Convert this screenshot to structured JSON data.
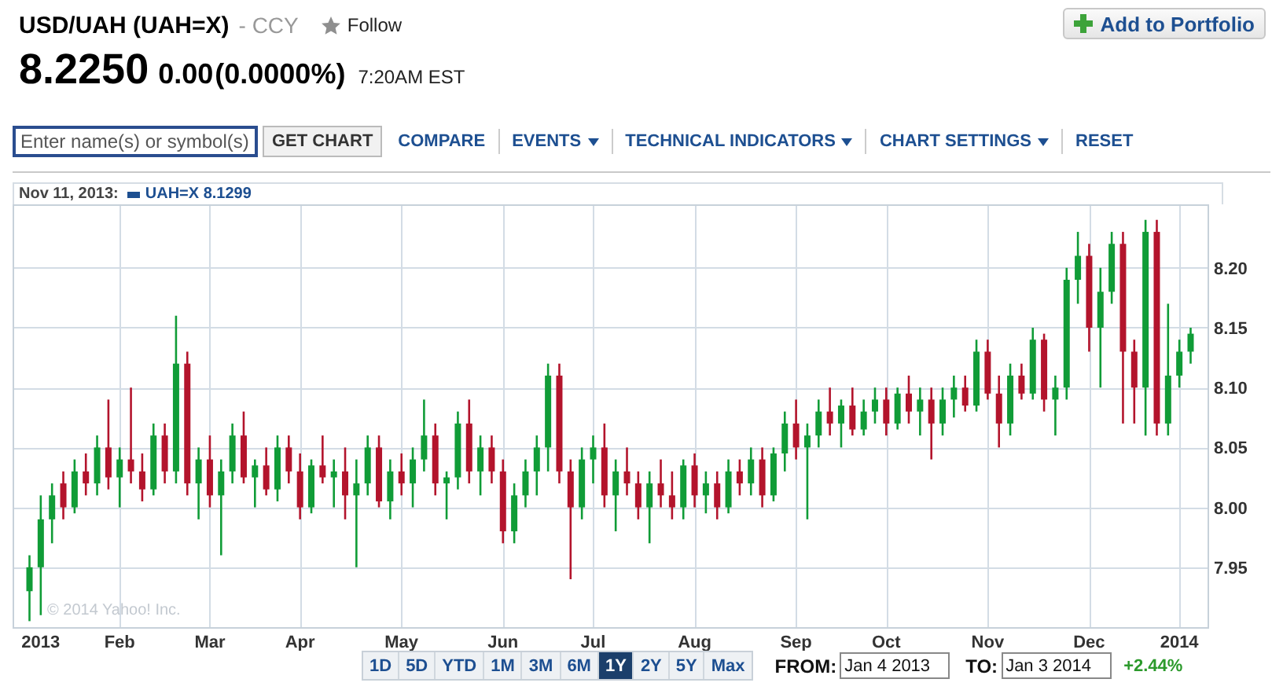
{
  "quote": {
    "title": "USD/UAH (UAH=X)",
    "exchange": "- CCY",
    "follow": "Follow",
    "price": "8.2250",
    "change": "0.00",
    "change_percent": "(0.0000%)",
    "time": "7:20AM EST"
  },
  "add_button": "Add to Portfolio",
  "toolbar": {
    "search": {
      "placeholder": "Enter name(s) or symbol(s)"
    },
    "get_chart": "GET CHART",
    "menu": [
      {
        "label": "COMPARE",
        "dropdown": false
      },
      {
        "label": "EVENTS",
        "dropdown": true
      },
      {
        "label": "TECHNICAL INDICATORS",
        "dropdown": true
      },
      {
        "label": "CHART SETTINGS",
        "dropdown": true
      },
      {
        "label": "RESET",
        "dropdown": false
      }
    ]
  },
  "chart": {
    "hover_date": "Nov 11, 2013:",
    "legend": "UAH=X 8.1299",
    "credit": "© 2014 Yahoo! Inc.",
    "chart_data": {
      "type": "candlestick",
      "categories": [
        null,
        "2013",
        null,
        null,
        null,
        null,
        null,
        null,
        "Feb",
        null,
        null,
        null,
        null,
        null,
        null,
        null,
        "Mar",
        null,
        null,
        null,
        null,
        null,
        null,
        null,
        "Apr",
        null,
        null,
        null,
        null,
        null,
        null,
        null,
        null,
        "May",
        null,
        null,
        null,
        null,
        null,
        null,
        null,
        null,
        "Jun",
        null,
        null,
        null,
        null,
        null,
        null,
        null,
        "Jul",
        null,
        null,
        null,
        null,
        null,
        null,
        null,
        null,
        "Aug",
        null,
        null,
        null,
        null,
        null,
        null,
        null,
        null,
        "Sep",
        null,
        null,
        null,
        null,
        null,
        null,
        null,
        "Oct",
        null,
        null,
        null,
        null,
        null,
        null,
        null,
        null,
        "Nov",
        null,
        null,
        null,
        null,
        null,
        null,
        null,
        null,
        "Dec",
        null,
        null,
        null,
        null,
        null,
        null,
        null,
        "2014",
        null
      ],
      "ohlc": [
        [
          7.93,
          7.96,
          7.905,
          7.95
        ],
        [
          7.95,
          8.01,
          7.91,
          7.99
        ],
        [
          7.99,
          8.02,
          7.97,
          8.01
        ],
        [
          8.02,
          8.03,
          7.99,
          8.0
        ],
        [
          8.0,
          8.04,
          7.995,
          8.03
        ],
        [
          8.03,
          8.045,
          8.01,
          8.02
        ],
        [
          8.02,
          8.06,
          8.01,
          8.05
        ],
        [
          8.05,
          8.09,
          8.015,
          8.025
        ],
        [
          8.025,
          8.05,
          8.0,
          8.04
        ],
        [
          8.04,
          8.1,
          8.02,
          8.03
        ],
        [
          8.03,
          8.045,
          8.005,
          8.015
        ],
        [
          8.015,
          8.07,
          8.01,
          8.06
        ],
        [
          8.06,
          8.07,
          8.02,
          8.03
        ],
        [
          8.03,
          8.16,
          8.02,
          8.12
        ],
        [
          8.12,
          8.13,
          8.01,
          8.02
        ],
        [
          8.02,
          8.05,
          7.99,
          8.04
        ],
        [
          8.04,
          8.06,
          8.0,
          8.01
        ],
        [
          8.01,
          8.04,
          7.96,
          8.03
        ],
        [
          8.03,
          8.07,
          8.02,
          8.06
        ],
        [
          8.06,
          8.08,
          8.02,
          8.025
        ],
        [
          8.025,
          8.04,
          8.0,
          8.035
        ],
        [
          8.035,
          8.05,
          8.01,
          8.015
        ],
        [
          8.015,
          8.06,
          8.005,
          8.05
        ],
        [
          8.05,
          8.06,
          8.02,
          8.03
        ],
        [
          8.03,
          8.045,
          7.99,
          8.0
        ],
        [
          8.0,
          8.04,
          7.995,
          8.035
        ],
        [
          8.035,
          8.06,
          8.02,
          8.025
        ],
        [
          8.025,
          8.04,
          8.0,
          8.03
        ],
        [
          8.03,
          8.05,
          7.99,
          8.01
        ],
        [
          8.01,
          8.04,
          7.95,
          8.02
        ],
        [
          8.02,
          8.06,
          8.01,
          8.05
        ],
        [
          8.05,
          8.06,
          8.0,
          8.005
        ],
        [
          8.005,
          8.04,
          7.99,
          8.03
        ],
        [
          8.03,
          8.045,
          8.01,
          8.02
        ],
        [
          8.02,
          8.05,
          8.0,
          8.04
        ],
        [
          8.04,
          8.09,
          8.03,
          8.06
        ],
        [
          8.06,
          8.07,
          8.01,
          8.02
        ],
        [
          8.02,
          8.03,
          7.99,
          8.025
        ],
        [
          8.025,
          8.08,
          8.015,
          8.07
        ],
        [
          8.07,
          8.09,
          8.02,
          8.03
        ],
        [
          8.03,
          8.06,
          8.01,
          8.05
        ],
        [
          8.05,
          8.06,
          8.02,
          8.03
        ],
        [
          8.03,
          8.04,
          7.97,
          7.98
        ],
        [
          7.98,
          8.02,
          7.97,
          8.01
        ],
        [
          8.01,
          8.04,
          8.0,
          8.03
        ],
        [
          8.03,
          8.06,
          8.01,
          8.05
        ],
        [
          8.05,
          8.12,
          8.03,
          8.11
        ],
        [
          8.11,
          8.12,
          8.02,
          8.03
        ],
        [
          8.03,
          8.04,
          7.94,
          8.0
        ],
        [
          8.0,
          8.05,
          7.99,
          8.04
        ],
        [
          8.04,
          8.06,
          8.02,
          8.05
        ],
        [
          8.05,
          8.07,
          8.0,
          8.01
        ],
        [
          8.01,
          8.04,
          7.98,
          8.03
        ],
        [
          8.03,
          8.05,
          8.01,
          8.02
        ],
        [
          8.02,
          8.03,
          7.99,
          8.0
        ],
        [
          8.0,
          8.03,
          7.97,
          8.02
        ],
        [
          8.02,
          8.04,
          8.0,
          8.01
        ],
        [
          8.01,
          8.03,
          7.99,
          8.0
        ],
        [
          8.0,
          8.04,
          7.99,
          8.035
        ],
        [
          8.035,
          8.045,
          8.0,
          8.01
        ],
        [
          8.01,
          8.03,
          7.995,
          8.02
        ],
        [
          8.02,
          8.03,
          7.99,
          8.0
        ],
        [
          8.0,
          8.04,
          7.995,
          8.03
        ],
        [
          8.03,
          8.04,
          8.01,
          8.02
        ],
        [
          8.02,
          8.05,
          8.01,
          8.04
        ],
        [
          8.04,
          8.05,
          8.0,
          8.01
        ],
        [
          8.01,
          8.05,
          8.005,
          8.045
        ],
        [
          8.045,
          8.08,
          8.03,
          8.07
        ],
        [
          8.07,
          8.09,
          8.04,
          8.05
        ],
        [
          8.05,
          8.07,
          7.99,
          8.06
        ],
        [
          8.06,
          8.09,
          8.05,
          8.08
        ],
        [
          8.08,
          8.1,
          8.06,
          8.07
        ],
        [
          8.07,
          8.09,
          8.05,
          8.085
        ],
        [
          8.085,
          8.1,
          8.06,
          8.065
        ],
        [
          8.065,
          8.09,
          8.06,
          8.08
        ],
        [
          8.08,
          8.1,
          8.07,
          8.09
        ],
        [
          8.09,
          8.1,
          8.06,
          8.07
        ],
        [
          8.07,
          8.1,
          8.065,
          8.095
        ],
        [
          8.095,
          8.11,
          8.07,
          8.08
        ],
        [
          8.08,
          8.1,
          8.06,
          8.09
        ],
        [
          8.09,
          8.1,
          8.04,
          8.07
        ],
        [
          8.07,
          8.1,
          8.06,
          8.09
        ],
        [
          8.09,
          8.11,
          8.075,
          8.1
        ],
        [
          8.1,
          8.11,
          8.08,
          8.085
        ],
        [
          8.085,
          8.14,
          8.08,
          8.13
        ],
        [
          8.13,
          8.14,
          8.09,
          8.095
        ],
        [
          8.095,
          8.11,
          8.05,
          8.07
        ],
        [
          8.07,
          8.12,
          8.06,
          8.11
        ],
        [
          8.11,
          8.12,
          8.09,
          8.095
        ],
        [
          8.095,
          8.15,
          8.09,
          8.14
        ],
        [
          8.14,
          8.145,
          8.08,
          8.09
        ],
        [
          8.09,
          8.11,
          8.06,
          8.1
        ],
        [
          8.1,
          8.2,
          8.09,
          8.19
        ],
        [
          8.19,
          8.23,
          8.17,
          8.21
        ],
        [
          8.21,
          8.22,
          8.13,
          8.15
        ],
        [
          8.15,
          8.2,
          8.1,
          8.18
        ],
        [
          8.18,
          8.23,
          8.17,
          8.22
        ],
        [
          8.22,
          8.23,
          8.07,
          8.13
        ],
        [
          8.13,
          8.14,
          8.07,
          8.1
        ],
        [
          8.1,
          8.24,
          8.06,
          8.23
        ],
        [
          8.23,
          8.24,
          8.06,
          8.07
        ],
        [
          8.07,
          8.17,
          8.06,
          8.11
        ],
        [
          8.11,
          8.14,
          8.1,
          8.13
        ],
        [
          8.13,
          8.15,
          8.12,
          8.145
        ]
      ],
      "grid": true,
      "ylim": [
        7.9,
        8.253
      ],
      "yticks": [
        {
          "value": 8.2,
          "label": "8.20"
        },
        {
          "value": 8.15,
          "label": "8.15"
        },
        {
          "value": 8.1,
          "label": "8.10"
        },
        {
          "value": 8.05,
          "label": "8.05"
        },
        {
          "value": 8.0,
          "label": "8.00"
        },
        {
          "value": 7.95,
          "label": "7.95"
        }
      ]
    }
  },
  "ranges": [
    {
      "label": "1D",
      "selected": false
    },
    {
      "label": "5D",
      "selected": false
    },
    {
      "label": "YTD",
      "selected": false
    },
    {
      "label": "1M",
      "selected": false
    },
    {
      "label": "3M",
      "selected": false
    },
    {
      "label": "6M",
      "selected": false
    },
    {
      "label": "1Y",
      "selected": true
    },
    {
      "label": "2Y",
      "selected": false
    },
    {
      "label": "5Y",
      "selected": false
    },
    {
      "label": "Max",
      "selected": false
    }
  ],
  "from": {
    "label": "FROM:",
    "value": "Jan 4 2013"
  },
  "to": {
    "label": "TO:",
    "value": "Jan 3 2014"
  },
  "period_change": "+2.44%"
}
